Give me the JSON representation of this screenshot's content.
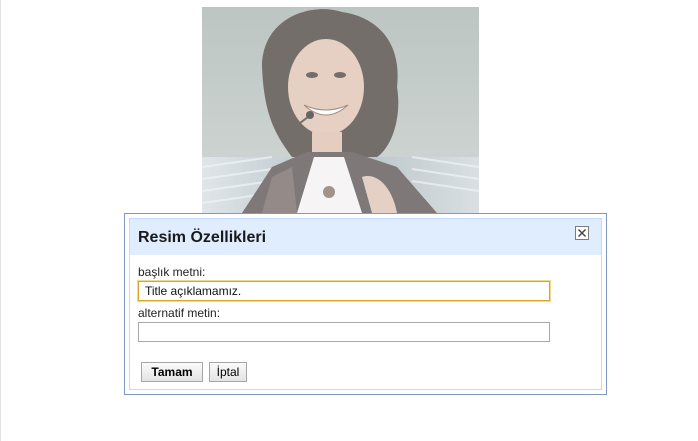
{
  "photo": {
    "icon": "portrait-photo"
  },
  "dialog": {
    "title": "Resim Özellikleri",
    "close_icon": "close-icon",
    "title_field": {
      "label": "başlık metni:",
      "value": "Title açıklamamız."
    },
    "alt_field": {
      "label": "alternatif metin:",
      "value": ""
    },
    "ok_label": "Tamam",
    "cancel_label": "İptal"
  },
  "colors": {
    "header_bg": "#e0edfe",
    "dialog_border": "#7f99c4",
    "focus_border": "#d9a81e"
  }
}
